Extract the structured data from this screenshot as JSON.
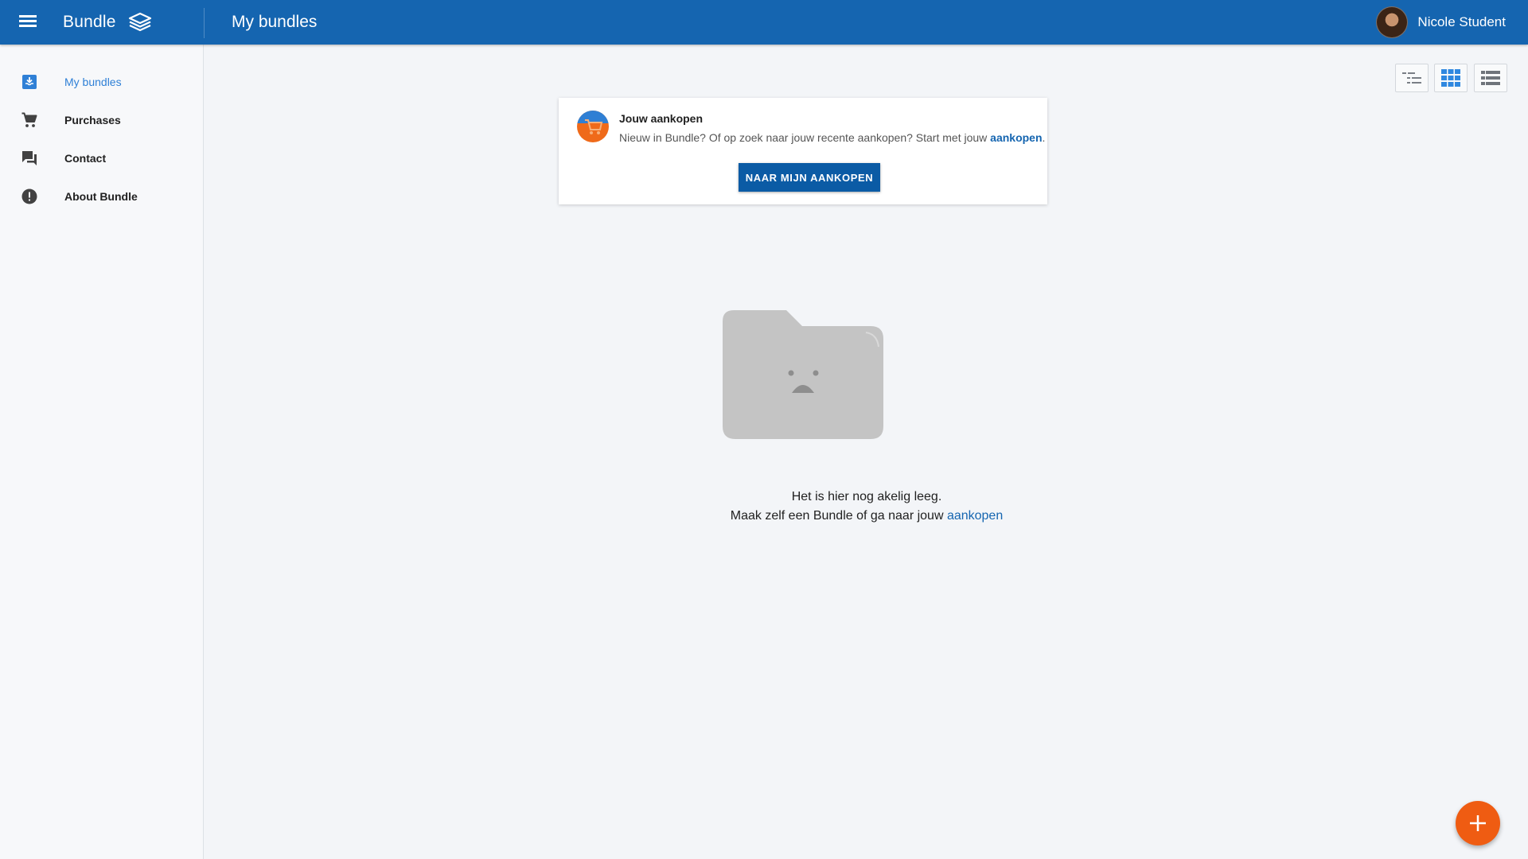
{
  "app": {
    "brand_name": "Bundle",
    "page_title": "My bundles",
    "user_name": "Nicole Student",
    "colors": {
      "primary": "#1565b0",
      "accent": "#ef5c12",
      "active_nav": "#2f80d6"
    }
  },
  "sidebar": {
    "items": [
      {
        "label": "My bundles",
        "icon": "bundle-download-icon",
        "active": true
      },
      {
        "label": "Purchases",
        "icon": "cart-icon",
        "active": false
      },
      {
        "label": "Contact",
        "icon": "chat-icon",
        "active": false
      },
      {
        "label": "About Bundle",
        "icon": "info-alert-icon",
        "active": false
      }
    ]
  },
  "view_toggles": [
    {
      "icon": "tree-list-view-icon",
      "selected": false
    },
    {
      "icon": "grid-view-icon",
      "selected": true
    },
    {
      "icon": "list-view-icon",
      "selected": false
    }
  ],
  "card": {
    "title": "Jouw aankopen",
    "text": "Nieuw in Bundle? Of op zoek naar jouw recente aankopen? Start met jouw ",
    "link": "aankopen",
    "text_end": ".",
    "button": "NAAR MIJN AANKOPEN"
  },
  "empty_state": {
    "line1": "Het is hier nog akelig leeg.",
    "line2": "Maak zelf een Bundle of ga naar jouw ",
    "link": "aankopen"
  },
  "fab": {
    "icon": "plus-icon"
  }
}
